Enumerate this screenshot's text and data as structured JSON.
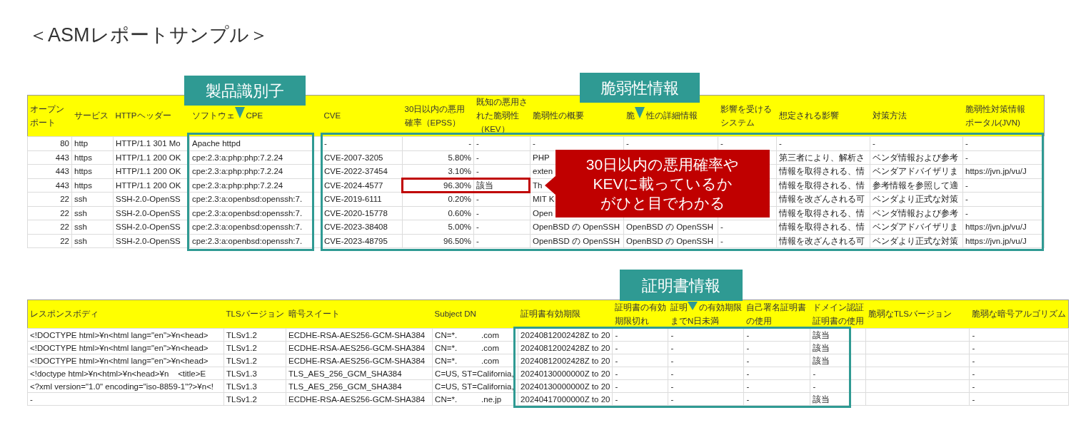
{
  "title": "＜ASMレポートサンプル＞",
  "top_table": {
    "columns": [
      {
        "lines": [
          [
            "オープン"
          ],
          [
            "ポート"
          ]
        ]
      },
      {
        "lines": [
          [
            "サービス"
          ]
        ]
      },
      {
        "lines": [
          [
            "HTTPヘッダー"
          ]
        ]
      },
      {
        "lines": [
          [
            "ソフトウェ",
            "CPE"
          ]
        ]
      },
      {
        "lines": [
          [
            "CVE"
          ]
        ]
      },
      {
        "lines": [
          [
            "30日以内の悪用"
          ],
          [
            "確率（EPSS）"
          ]
        ]
      },
      {
        "lines": [
          [
            "既知の悪用さ"
          ],
          [
            "れた脆弱性"
          ],
          [
            "（KEV）"
          ]
        ]
      },
      {
        "lines": [
          [
            "脆弱性の概要"
          ]
        ]
      },
      {
        "lines": [
          [
            "脆",
            "性の詳細情報"
          ]
        ]
      },
      {
        "lines": [
          [
            "影響を受ける"
          ],
          [
            "システム"
          ]
        ]
      },
      {
        "lines": [
          [
            "想定される影響"
          ]
        ]
      },
      {
        "lines": [
          [
            "対策方法"
          ]
        ]
      },
      {
        "lines": [
          [
            "脆弱性対策情報"
          ],
          [
            "ポータル(JVN)"
          ]
        ]
      }
    ],
    "rows": [
      {
        "cells": [
          "80",
          "http",
          "HTTP/1.1 301 Mo",
          "Apache httpd",
          "-",
          "-",
          "-",
          "-",
          "-",
          "-",
          "-",
          "-",
          "-"
        ]
      },
      {
        "cells": [
          "443",
          "https",
          "HTTP/1.1 200 OK",
          "cpe:2.3:a:php:php:7.2.24",
          "CVE-2007-3205",
          "5.80%",
          "-",
          "PHP",
          null,
          null,
          "第三者により、解析さ",
          "ベンダ情報および参考",
          "-"
        ]
      },
      {
        "cells": [
          "443",
          "https",
          "HTTP/1.1 200 OK",
          "cpe:2.3:a:php:php:7.2.24",
          "CVE-2022-37454",
          "3.10%",
          "-",
          "exten",
          null,
          null,
          "情報を取得される、情",
          "ベンダアドバイザリま",
          "https://jvn.jp/vu/J"
        ]
      },
      {
        "cells": [
          "443",
          "https",
          "HTTP/1.1 200 OK",
          "cpe:2.3:a:php:php:7.2.24",
          "CVE-2024-4577",
          "96.30%",
          "該当",
          "Th",
          null,
          null,
          "情報を取得される、情",
          "参考情報を参照して適",
          "-"
        ]
      },
      {
        "cells": [
          "22",
          "ssh",
          "SSH-2.0-OpenSS",
          "cpe:2.3:a:openbsd:openssh:7.",
          "CVE-2019-6111",
          "0.20%",
          "-",
          "MIT K",
          null,
          null,
          "情報を改ざんされる可",
          "ベンダより正式な対策",
          "-"
        ]
      },
      {
        "cells": [
          "22",
          "ssh",
          "SSH-2.0-OpenSS",
          "cpe:2.3:a:openbsd:openssh:7.",
          "CVE-2020-15778",
          "0.60%",
          "-",
          "Open",
          null,
          null,
          "情報を取得される、情",
          "ベンダ情報および参考",
          "-"
        ]
      },
      {
        "cells": [
          "22",
          "ssh",
          "SSH-2.0-OpenSS",
          "cpe:2.3:a:openbsd:openssh:7.",
          "CVE-2023-38408",
          "5.00%",
          "-",
          "OpenBSD の OpenSSH",
          "OpenBSD の OpenSSH",
          "-",
          "情報を取得される、情",
          "ベンダアドバイザリま",
          "https://jvn.jp/vu/J"
        ]
      },
      {
        "cells": [
          "22",
          "ssh",
          "SSH-2.0-OpenSS",
          "cpe:2.3:a:openbsd:openssh:7.",
          "CVE-2023-48795",
          "96.50%",
          "-",
          "OpenBSD の OpenSSH",
          "OpenBSD の OpenSSH",
          "-",
          "情報を改ざんされる可",
          "ベンダより正式な対策",
          "https://jvn.jp/vu/J"
        ]
      }
    ]
  },
  "bottom_table": {
    "columns": [
      {
        "lines": [
          [
            "レスポンスボディ"
          ]
        ]
      },
      {
        "lines": [
          [
            "TLSバージョン"
          ]
        ]
      },
      {
        "lines": [
          [
            "暗号スイート"
          ]
        ]
      },
      {
        "lines": [
          [
            "Subject DN"
          ]
        ]
      },
      {
        "lines": [
          [
            "証明書有効期限"
          ]
        ]
      },
      {
        "lines": [
          [
            "証明書の有効"
          ],
          [
            "期限切れ"
          ]
        ]
      },
      {
        "lines": [
          [
            "証明",
            "の有効期限"
          ],
          [
            "までN日未満"
          ]
        ]
      },
      {
        "lines": [
          [
            "自己署名証明書"
          ],
          [
            "の使用"
          ]
        ]
      },
      {
        "lines": [
          [
            "ドメイン認証"
          ],
          [
            "証明書の使用"
          ]
        ]
      },
      {
        "lines": [
          [
            "脆弱なTLSバージョン"
          ]
        ]
      },
      {
        "lines": [
          [
            "脆弱な暗号アルゴリズム"
          ]
        ]
      }
    ],
    "rows": [
      {
        "cells": [
          "<!DOCTYPE html>¥n<html lang=\"en\">¥n<head>",
          "TLSv1.2",
          "ECDHE-RSA-AES256-GCM-SHA384",
          [
            "CN=*.",
            ".com"
          ],
          "20240812002428Z to 20",
          "-",
          "-",
          "-",
          "該当",
          null,
          "-"
        ]
      },
      {
        "cells": [
          "<!DOCTYPE html>¥n<html lang=\"en\">¥n<head>",
          "TLSv1.2",
          "ECDHE-RSA-AES256-GCM-SHA384",
          [
            "CN=*.",
            ".com"
          ],
          "20240812002428Z to 20",
          "-",
          "-",
          "-",
          "該当",
          null,
          "-"
        ]
      },
      {
        "cells": [
          "<!DOCTYPE html>¥n<html lang=\"en\">¥n<head>",
          "TLSv1.2",
          "ECDHE-RSA-AES256-GCM-SHA384",
          [
            "CN=*.",
            ".com"
          ],
          "20240812002428Z to 20",
          "-",
          "-",
          "-",
          "該当",
          null,
          "-"
        ]
      },
      {
        "cells": [
          "<!doctype html>¥n<html>¥n<head>¥n    <title>E",
          "TLSv1.3",
          "TLS_AES_256_GCM_SHA384",
          "C=US, ST=California,",
          "20240130000000Z to 20",
          "-",
          "-",
          "-",
          "-",
          null,
          "-"
        ]
      },
      {
        "cells": [
          "<?xml version=\"1.0\" encoding=\"iso-8859-1\"?>¥n<!",
          "TLSv1.3",
          "TLS_AES_256_GCM_SHA384",
          "C=US, ST=California,",
          "20240130000000Z to 20",
          "-",
          "-",
          "-",
          "-",
          null,
          "-"
        ]
      },
      {
        "cells": [
          "-",
          "TLSv1.2",
          "ECDHE-RSA-AES256-GCM-SHA384",
          [
            "CN=*.",
            ".ne.jp"
          ],
          "20240417000000Z to 20",
          "-",
          "-",
          "-",
          "該当",
          null,
          "-"
        ]
      }
    ]
  },
  "annotations": {
    "product_label": "製品識別子",
    "vulnerability_label": "脆弱性情報",
    "callout": [
      "30日以内の悪用確率や",
      "KEVに載っているか",
      "がひと目でわかる"
    ],
    "certificate_label": "証明書情報"
  }
}
